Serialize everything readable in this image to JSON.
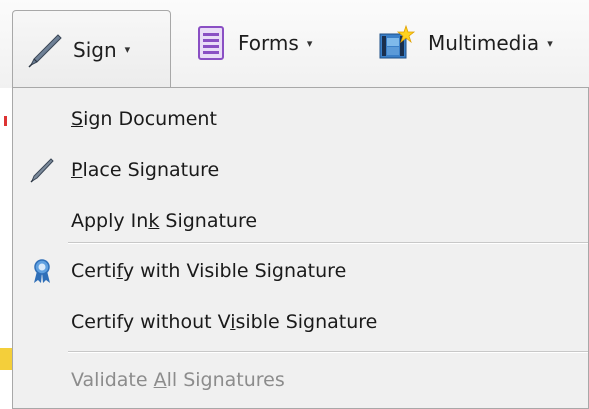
{
  "toolbar": {
    "sign": {
      "label": "Sign",
      "caret": "▾",
      "icon": "pen-icon"
    },
    "forms": {
      "label": "Forms",
      "caret": "▾",
      "icon": "forms-icon"
    },
    "multimedia": {
      "label": "Multimedia",
      "caret": "▾",
      "icon": "multimedia-icon"
    }
  },
  "menu": {
    "items": [
      {
        "pre": "",
        "accel": "S",
        "post": "ign Document",
        "enabled": true
      },
      {
        "pre": "",
        "accel": "P",
        "post": "lace Signature",
        "enabled": true,
        "icon": "pen-icon"
      },
      {
        "pre": "Apply In",
        "accel": "k",
        "post": " Signature",
        "enabled": true
      },
      {
        "pre": "Certi",
        "accel": "f",
        "post": "y with Visible Signature",
        "enabled": true,
        "icon": "ribbon-icon"
      },
      {
        "pre": "Certify without V",
        "accel": "i",
        "post": "sible Signature",
        "enabled": true
      },
      {
        "pre": "Validate ",
        "accel": "A",
        "post": "ll Signatures",
        "enabled": false
      }
    ]
  },
  "colors": {
    "menu_bg": "#f0f0f0",
    "disabled_text": "#8c8c8c",
    "forms_icon": "#8a4fc4",
    "ribbon_icon": "#2f6fb8"
  }
}
